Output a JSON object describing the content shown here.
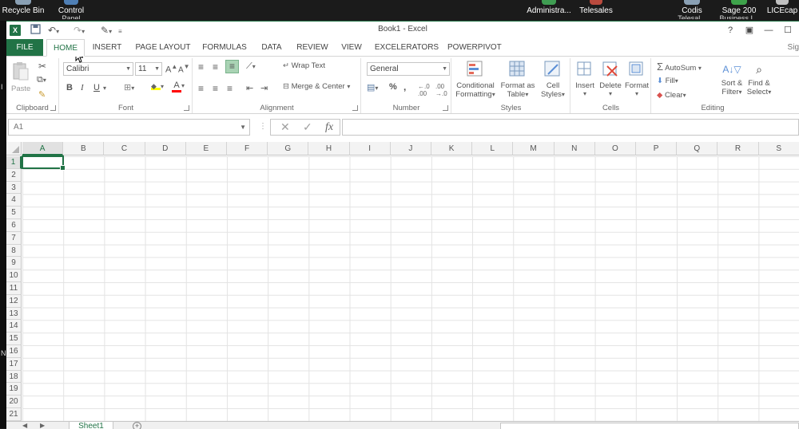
{
  "desktop": {
    "icons": [
      {
        "label": "Recycle Bin",
        "label2": ""
      },
      {
        "label": "Control",
        "label2": "Panel"
      },
      {
        "label": "Administra...",
        "label2": ""
      },
      {
        "label": "Telesales",
        "label2": ""
      },
      {
        "label": "Codis",
        "label2": "Telesal..."
      },
      {
        "label": "Sage 200",
        "label2": "Business I..."
      },
      {
        "label": "LICEcap",
        "label2": ""
      }
    ]
  },
  "titlebar": {
    "app_icon": "X",
    "title": "Book1 - Excel",
    "help": "?",
    "restore_ribbon": "▣",
    "minimize": "—",
    "maximize": "☐"
  },
  "tabs": {
    "items": [
      "FILE",
      "HOME",
      "INSERT",
      "PAGE LAYOUT",
      "FORMULAS",
      "DATA",
      "REVIEW",
      "VIEW",
      "EXCELERATORS",
      "POWERPIVOT"
    ],
    "active": "HOME",
    "signin": "Sig"
  },
  "ribbon": {
    "clipboard": {
      "label": "Clipboard",
      "paste": "Paste"
    },
    "font": {
      "label": "Font",
      "name": "Calibri",
      "size": "11",
      "bold": "B",
      "italic": "I",
      "underline": "U"
    },
    "alignment": {
      "label": "Alignment",
      "wrap": "Wrap Text",
      "merge": "Merge & Center"
    },
    "number": {
      "label": "Number",
      "format": "General",
      "percent": "%",
      "comma": ","
    },
    "styles": {
      "label": "Styles",
      "conditional_1": "Conditional",
      "conditional_2": "Formatting",
      "format_table_1": "Format as",
      "format_table_2": "Table",
      "cell_styles_1": "Cell",
      "cell_styles_2": "Styles"
    },
    "cells": {
      "label": "Cells",
      "insert": "Insert",
      "delete": "Delete",
      "format": "Format"
    },
    "editing": {
      "label": "Editing",
      "autosum": "AutoSum",
      "fill": "Fill",
      "clear": "Clear",
      "sort_1": "Sort &",
      "sort_2": "Filter",
      "find_1": "Find &",
      "find_2": "Select"
    }
  },
  "formula_bar": {
    "name_box": "A1",
    "value": ""
  },
  "grid": {
    "columns": [
      "A",
      "B",
      "C",
      "D",
      "E",
      "F",
      "G",
      "H",
      "I",
      "J",
      "K",
      "L",
      "M",
      "N",
      "O",
      "P",
      "Q",
      "R",
      "S"
    ],
    "rows": [
      "1",
      "2",
      "3",
      "4",
      "5",
      "6",
      "7",
      "8",
      "9",
      "10",
      "11",
      "12",
      "13",
      "14",
      "15",
      "16",
      "17",
      "18",
      "19",
      "20",
      "21"
    ],
    "selected_column": "A",
    "selected_row": "1"
  },
  "sheets": {
    "tabs": [
      "Sheet1"
    ],
    "add": "+"
  },
  "left_strip": {
    "chars": [
      "I",
      "N"
    ]
  }
}
